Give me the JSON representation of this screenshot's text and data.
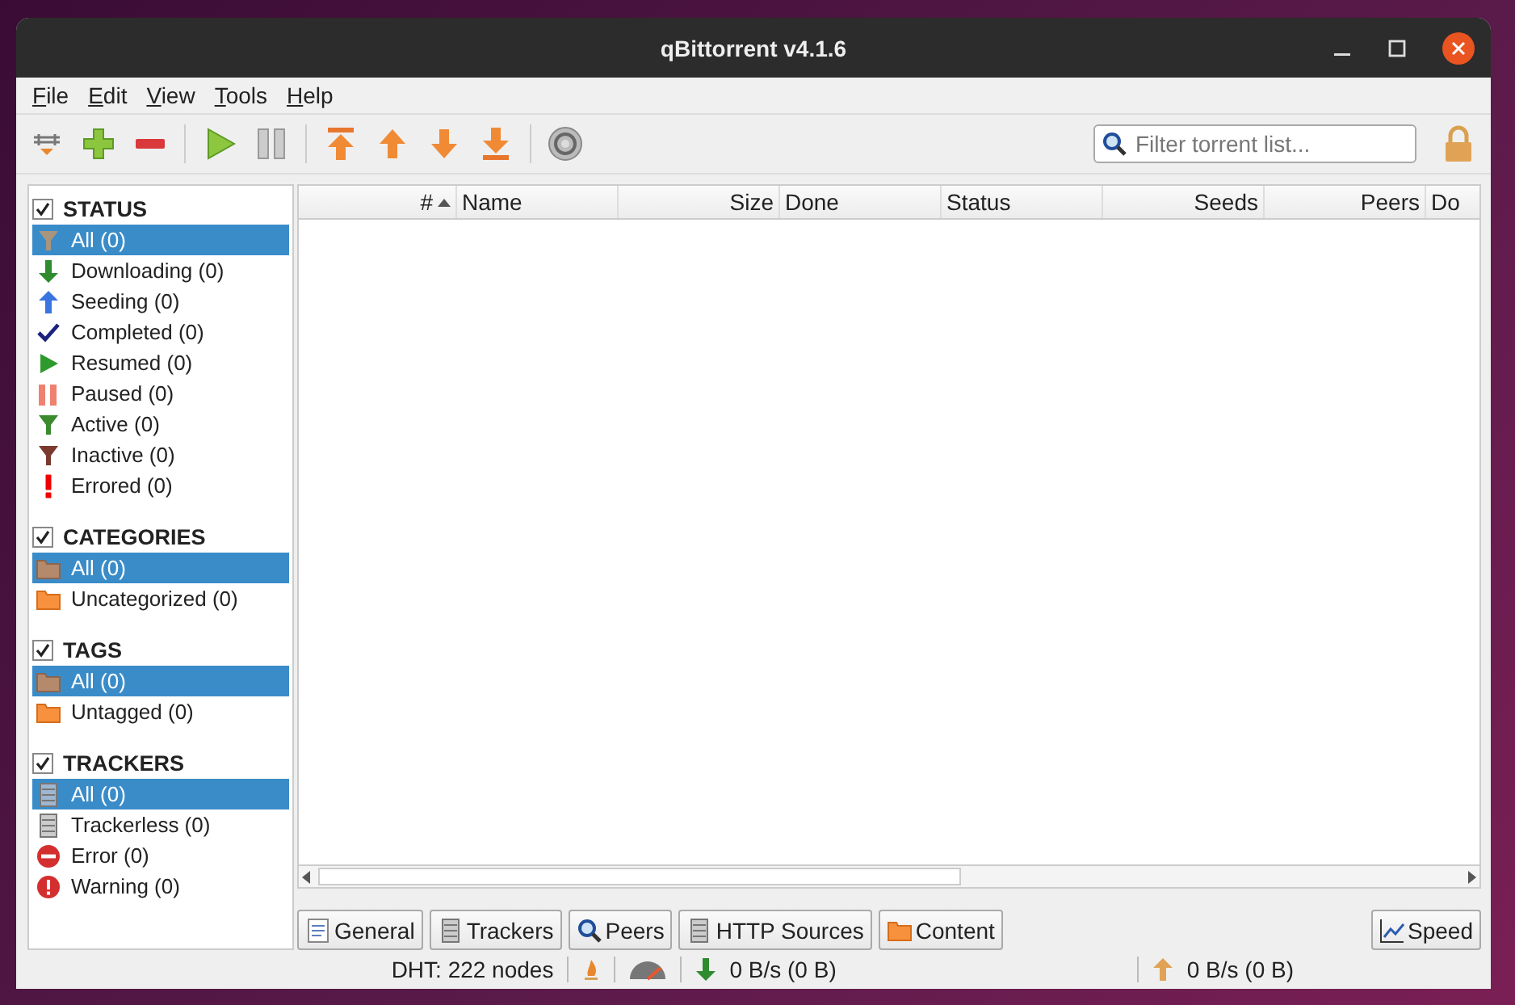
{
  "window": {
    "title": "qBittorrent v4.1.6"
  },
  "menu": [
    {
      "label": "File"
    },
    {
      "label": "Edit"
    },
    {
      "label": "View"
    },
    {
      "label": "Tools"
    },
    {
      "label": "Help"
    }
  ],
  "search": {
    "placeholder": "Filter torrent list..."
  },
  "sidebar": [
    {
      "title": "STATUS",
      "checked": true,
      "items": [
        {
          "label": "All (0)",
          "kind": "filter-all",
          "selected": true
        },
        {
          "label": "Downloading (0)",
          "kind": "down",
          "selected": false
        },
        {
          "label": "Seeding (0)",
          "kind": "up",
          "selected": false
        },
        {
          "label": "Completed (0)",
          "kind": "check",
          "selected": false
        },
        {
          "label": "Resumed (0)",
          "kind": "play",
          "selected": false
        },
        {
          "label": "Paused (0)",
          "kind": "pause",
          "selected": false
        },
        {
          "label": "Active (0)",
          "kind": "filter-active",
          "selected": false
        },
        {
          "label": "Inactive (0)",
          "kind": "filter-inactive",
          "selected": false
        },
        {
          "label": "Errored (0)",
          "kind": "exclaim",
          "selected": false
        }
      ]
    },
    {
      "title": "CATEGORIES",
      "checked": true,
      "items": [
        {
          "label": "All (0)",
          "kind": "folder-all",
          "selected": true
        },
        {
          "label": "Uncategorized (0)",
          "kind": "folder",
          "selected": false
        }
      ]
    },
    {
      "title": "TAGS",
      "checked": true,
      "items": [
        {
          "label": "All (0)",
          "kind": "folder-all",
          "selected": true
        },
        {
          "label": "Untagged (0)",
          "kind": "folder",
          "selected": false
        }
      ]
    },
    {
      "title": "TRACKERS",
      "checked": true,
      "items": [
        {
          "label": "All (0)",
          "kind": "server",
          "selected": true
        },
        {
          "label": "Trackerless (0)",
          "kind": "server",
          "selected": false
        },
        {
          "label": "Error (0)",
          "kind": "error",
          "selected": false
        },
        {
          "label": "Warning (0)",
          "kind": "warning",
          "selected": false
        }
      ]
    }
  ],
  "table": {
    "columns": [
      {
        "label": "#",
        "kind": "number",
        "sorted": true
      },
      {
        "label": "Name",
        "kind": "text",
        "sorted": false
      },
      {
        "label": "Size",
        "kind": "number",
        "sorted": false
      },
      {
        "label": "Done",
        "kind": "text",
        "sorted": false
      },
      {
        "label": "Status",
        "kind": "text",
        "sorted": false
      },
      {
        "label": "Seeds",
        "kind": "number",
        "sorted": false
      },
      {
        "label": "Peers",
        "kind": "number",
        "sorted": false
      },
      {
        "label": "Do",
        "kind": "text",
        "sorted": false
      }
    ]
  },
  "detail_tabs": [
    {
      "label": "General",
      "kind": "doc"
    },
    {
      "label": "Trackers",
      "kind": "server"
    },
    {
      "label": "Peers",
      "kind": "search"
    },
    {
      "label": "HTTP Sources",
      "kind": "server"
    },
    {
      "label": "Content",
      "kind": "folder"
    }
  ],
  "speed_button": {
    "label": "Speed"
  },
  "status_bar": {
    "dht": "DHT: 222 nodes",
    "download": "0 B/s (0 B)",
    "upload": "0 B/s (0 B)"
  }
}
